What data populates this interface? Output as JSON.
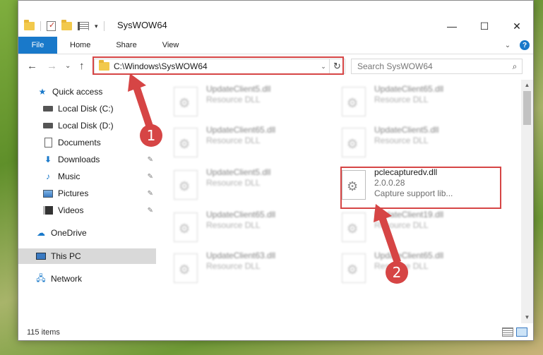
{
  "window": {
    "title": "SysWOW64",
    "controls": {
      "minimize": "—",
      "maximize": "☐",
      "close": "✕"
    }
  },
  "ribbon": {
    "tabs": [
      {
        "label": "File"
      },
      {
        "label": "Home"
      },
      {
        "label": "Share"
      },
      {
        "label": "View"
      }
    ],
    "expand_glyph": "⌄",
    "help_glyph": "?"
  },
  "navbar": {
    "back": "←",
    "forward": "→",
    "recent": "⌄",
    "up": "↑",
    "address": "C:\\Windows\\SysWOW64",
    "address_dropdown": "⌄",
    "refresh": "↻",
    "search_placeholder": "Search SysWOW64",
    "search_glyph": "⌕"
  },
  "navpane": {
    "items": [
      {
        "label": "Quick access",
        "icon": "star-icon",
        "pinned": false
      },
      {
        "label": "Local Disk (C:)",
        "icon": "drive-icon",
        "pinned": false
      },
      {
        "label": "Local Disk (D:)",
        "icon": "drive-icon",
        "pinned": false
      },
      {
        "label": "Documents",
        "icon": "document-icon",
        "pinned": false
      },
      {
        "label": "Downloads",
        "icon": "download-icon",
        "pinned": true
      },
      {
        "label": "Music",
        "icon": "music-icon",
        "pinned": true
      },
      {
        "label": "Pictures",
        "icon": "pictures-icon",
        "pinned": true
      },
      {
        "label": "Videos",
        "icon": "videos-icon",
        "pinned": true
      },
      {
        "label": "OneDrive",
        "icon": "cloud-icon",
        "pinned": false
      },
      {
        "label": "This PC",
        "icon": "computer-icon",
        "pinned": false,
        "selected": true
      },
      {
        "label": "Network",
        "icon": "network-icon",
        "pinned": false
      }
    ],
    "pin_glyph": "📌"
  },
  "files": [
    {
      "name": "UpdateClient5.dll",
      "type": "Resource DLL",
      "blurred": true
    },
    {
      "name": "UpdateClient65.dll",
      "type": "Resource DLL",
      "blurred": true
    },
    {
      "name": "UpdateClient65.dll",
      "type": "Resource DLL",
      "blurred": true
    },
    {
      "name": "UpdateClient5.dll",
      "type": "Resource DLL",
      "blurred": true
    },
    {
      "name": "UpdateClient5.dll",
      "type": "Resource DLL",
      "blurred": true
    },
    {
      "name": "pclecapturedv.dll",
      "version": "2.0.0.28",
      "type": "Capture support lib...",
      "blurred": false
    },
    {
      "name": "UpdateClient65.dll",
      "type": "Resource DLL",
      "blurred": true
    },
    {
      "name": "UpdateClient19.dll",
      "type": "Resource DLL",
      "blurred": true
    },
    {
      "name": "UpdateClient63.dll",
      "type": "Resource DLL",
      "blurred": true
    },
    {
      "name": "UpdateClient65.dll",
      "type": "Resource DLL",
      "blurred": true
    }
  ],
  "status": {
    "item_count": "115 items"
  },
  "annotations": [
    {
      "number": "1",
      "color": "#d64545"
    },
    {
      "number": "2",
      "color": "#d64545"
    }
  ],
  "scrollbar": {
    "up": "▲",
    "down": "▼"
  }
}
